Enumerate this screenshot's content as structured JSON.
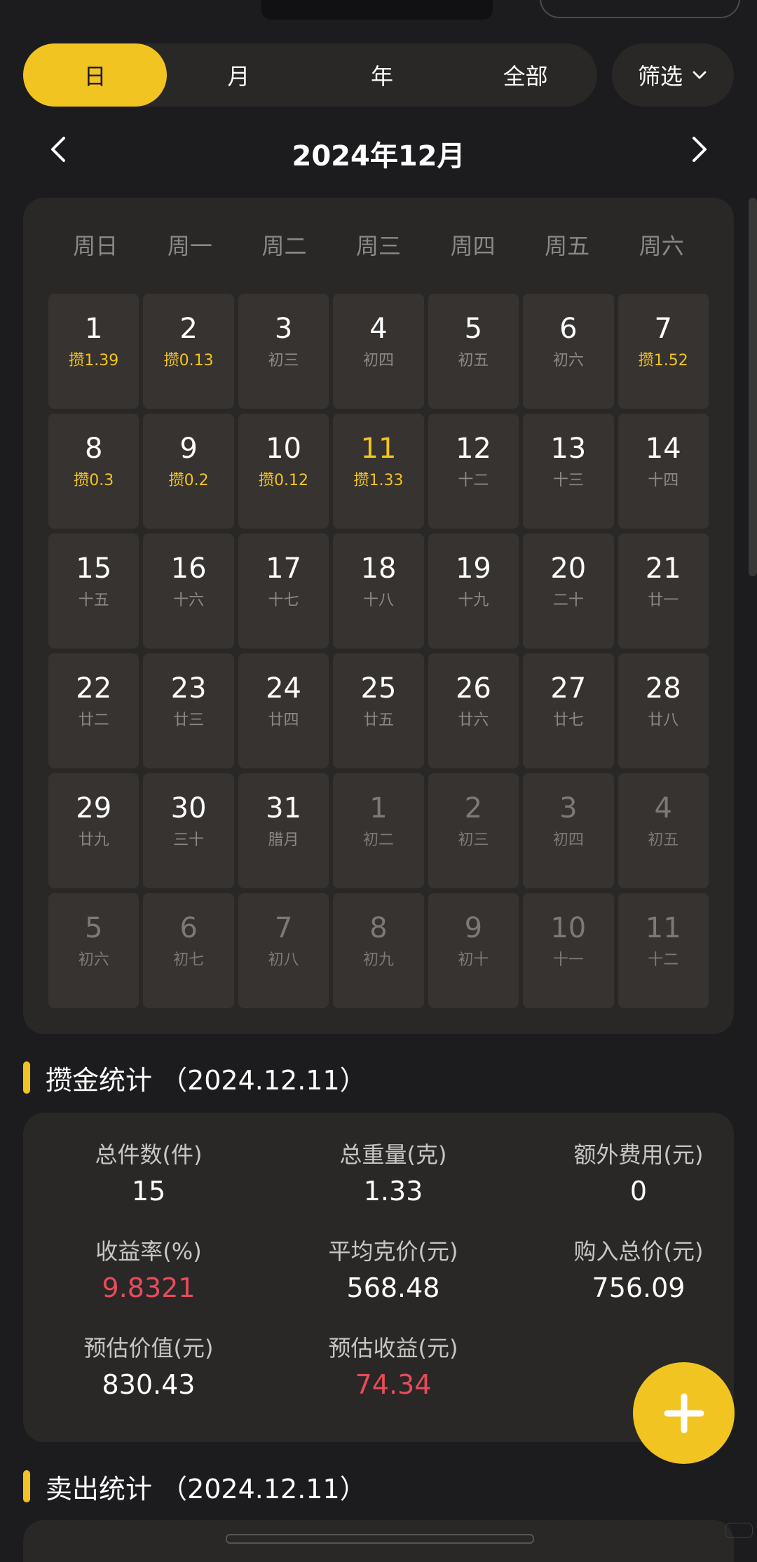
{
  "tabs": {
    "items": [
      "日",
      "月",
      "年",
      "全部"
    ],
    "active_index": 0
  },
  "filter": {
    "label": "筛选"
  },
  "calendar": {
    "title": "2024年12月",
    "weekdays": [
      "周日",
      "周一",
      "周二",
      "周三",
      "周四",
      "周五",
      "周六"
    ],
    "weeks": [
      [
        {
          "n": "1",
          "sub": "攒1.39",
          "saved": true
        },
        {
          "n": "2",
          "sub": "攒0.13",
          "saved": true
        },
        {
          "n": "3",
          "sub": "初三"
        },
        {
          "n": "4",
          "sub": "初四"
        },
        {
          "n": "5",
          "sub": "初五"
        },
        {
          "n": "6",
          "sub": "初六"
        },
        {
          "n": "7",
          "sub": "攒1.52",
          "saved": true
        }
      ],
      [
        {
          "n": "8",
          "sub": "攒0.3",
          "saved": true
        },
        {
          "n": "9",
          "sub": "攒0.2",
          "saved": true
        },
        {
          "n": "10",
          "sub": "攒0.12",
          "saved": true
        },
        {
          "n": "11",
          "sub": "攒1.33",
          "saved": true,
          "today": true
        },
        {
          "n": "12",
          "sub": "十二"
        },
        {
          "n": "13",
          "sub": "十三"
        },
        {
          "n": "14",
          "sub": "十四"
        }
      ],
      [
        {
          "n": "15",
          "sub": "十五"
        },
        {
          "n": "16",
          "sub": "十六"
        },
        {
          "n": "17",
          "sub": "十七"
        },
        {
          "n": "18",
          "sub": "十八"
        },
        {
          "n": "19",
          "sub": "十九"
        },
        {
          "n": "20",
          "sub": "二十"
        },
        {
          "n": "21",
          "sub": "廿一"
        }
      ],
      [
        {
          "n": "22",
          "sub": "廿二"
        },
        {
          "n": "23",
          "sub": "廿三"
        },
        {
          "n": "24",
          "sub": "廿四"
        },
        {
          "n": "25",
          "sub": "廿五"
        },
        {
          "n": "26",
          "sub": "廿六"
        },
        {
          "n": "27",
          "sub": "廿七"
        },
        {
          "n": "28",
          "sub": "廿八"
        }
      ],
      [
        {
          "n": "29",
          "sub": "廿九"
        },
        {
          "n": "30",
          "sub": "三十"
        },
        {
          "n": "31",
          "sub": "腊月"
        },
        {
          "n": "1",
          "sub": "初二",
          "other": true
        },
        {
          "n": "2",
          "sub": "初三",
          "other": true
        },
        {
          "n": "3",
          "sub": "初四",
          "other": true
        },
        {
          "n": "4",
          "sub": "初五",
          "other": true
        }
      ],
      [
        {
          "n": "5",
          "sub": "初六",
          "other": true
        },
        {
          "n": "6",
          "sub": "初七",
          "other": true
        },
        {
          "n": "7",
          "sub": "初八",
          "other": true
        },
        {
          "n": "8",
          "sub": "初九",
          "other": true
        },
        {
          "n": "9",
          "sub": "初十",
          "other": true
        },
        {
          "n": "10",
          "sub": "十一",
          "other": true
        },
        {
          "n": "11",
          "sub": "十二",
          "other": true
        }
      ]
    ]
  },
  "savings_stats": {
    "title": "攒金统计 （2024.12.11）",
    "items": [
      {
        "label": "总件数(件)",
        "value": "15"
      },
      {
        "label": "总重量(克)",
        "value": "1.33"
      },
      {
        "label": "额外费用(元)",
        "value": "0"
      },
      {
        "label": "收益率(%)",
        "value": "9.8321",
        "highlight": true
      },
      {
        "label": "平均克价(元)",
        "value": "568.48"
      },
      {
        "label": "购入总价(元)",
        "value": "756.09"
      },
      {
        "label": "预估价值(元)",
        "value": "830.43"
      },
      {
        "label": "预估收益(元)",
        "value": "74.34",
        "highlight": true
      }
    ]
  },
  "sold_stats": {
    "title": "卖出统计 （2024.12.11）"
  },
  "colors": {
    "accent": "#f2c421",
    "background": "#1c1c1e",
    "card": "#2a2826",
    "day_cell": "#363330",
    "negative_red": "#e84b5b",
    "muted_text": "#8b8986"
  },
  "icons": {
    "prev": "chevron-left-icon",
    "next": "chevron-right-icon",
    "filter": "chevron-down-icon",
    "fab": "plus-icon"
  }
}
